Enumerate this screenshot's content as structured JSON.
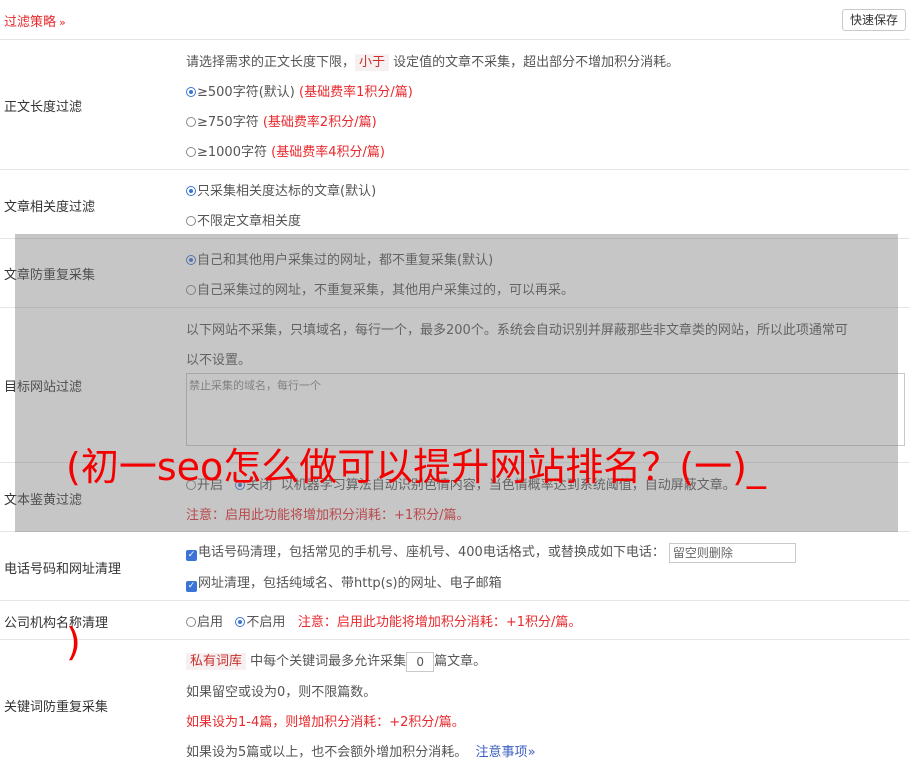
{
  "header": {
    "title": "过滤策略",
    "chevron": "»",
    "save_label": "快速保存"
  },
  "length_filter": {
    "label": "正文长度过滤",
    "desc_pre": "请选择需求的正文长度下限，",
    "desc_tag": "小于",
    "desc_post": "设定值的文章不采集，超出部分不增加积分消耗。",
    "options": [
      {
        "text": "≥500字符(默认)",
        "note": "(基础费率1积分/篇)"
      },
      {
        "text": "≥750字符",
        "note": "(基础费率2积分/篇)"
      },
      {
        "text": "≥1000字符",
        "note": "(基础费率4积分/篇)"
      }
    ]
  },
  "relevance_filter": {
    "label": "文章相关度过滤",
    "options": [
      "只采集相关度达标的文章(默认)",
      "不限定文章相关度"
    ]
  },
  "duplicate_filter": {
    "label": "文章防重复采集",
    "options": [
      "自己和其他用户采集过的网址，都不重复采集(默认)",
      "自己采集过的网址，不重复采集，其他用户采集过的，可以再采。"
    ]
  },
  "site_filter": {
    "label": "目标网站过滤",
    "desc1": "以下网站不采集，只填域名，每行一个，最多200个。系统会自动识别并屏蔽那些非文章类的网站，所以此项通常可",
    "desc2": "以不设置。",
    "placeholder": "禁止采集的域名，每行一个"
  },
  "porn_filter": {
    "label": "文本鉴黄过滤",
    "on": "开启",
    "off": "关闭",
    "desc": "以机器学习算法自动识别色情内容，当色情概率达到系统阈值，自动屏蔽文章。",
    "note": "注意：启用此功能将增加积分消耗：+1积分/篇。"
  },
  "phone_filter": {
    "label": "电话号码和网址清理",
    "phone_text": "电话号码清理，包括常见的手机号、座机号、400电话格式，或替换成如下电话：",
    "phone_placeholder": "留空则删除",
    "url_text": "网址清理，包括纯域名、带http(s)的网址、电子邮箱"
  },
  "org_filter": {
    "label": "公司机构名称清理",
    "on": "启用",
    "off": "不启用",
    "note": "注意：启用此功能将增加积分消耗：+1积分/篇。"
  },
  "keyword_filter": {
    "label": "关键词防重复采集",
    "tag": "私有词库",
    "line1_pre": "中每个关键词最多允许采集",
    "value": "0",
    "line1_post": "篇文章。",
    "line2": "如果留空或设为0，则不限篇数。",
    "line3": "如果设为1-4篇，则增加积分消耗：+2积分/篇。",
    "line4": "如果设为5篇或以上，也不会额外增加积分消耗。",
    "notice": "注意事项",
    "notice_chev": "»"
  },
  "watermark": {
    "line1": "(初一seo怎么做可以提升网站排名？(一)_",
    "line2": ")"
  },
  "colors": {
    "accent": "#e8292d",
    "radio": "#3b74d6"
  }
}
